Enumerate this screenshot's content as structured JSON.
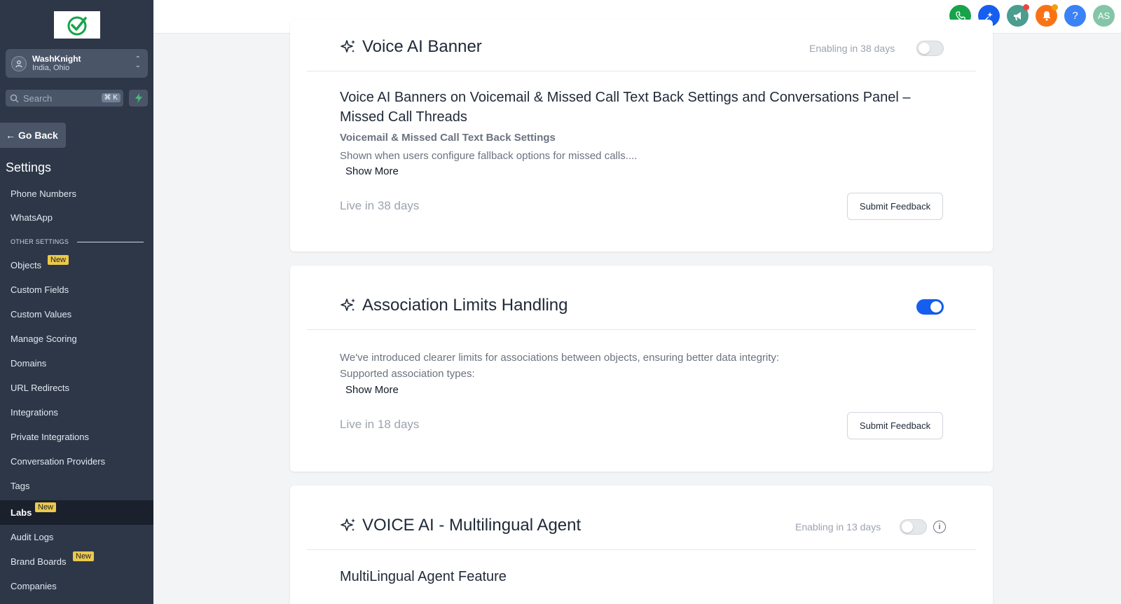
{
  "sidebar": {
    "account": {
      "name": "WashKnight",
      "location": "India, Ohio"
    },
    "search": {
      "placeholder": "Search",
      "shortcut": "⌘ K"
    },
    "go_back": "Go Back",
    "settings_title": "Settings",
    "other_settings_label": "OTHER SETTINGS",
    "new_badge": "New",
    "items": {
      "phone_numbers": "Phone Numbers",
      "whatsapp": "WhatsApp",
      "objects": "Objects",
      "custom_fields": "Custom Fields",
      "custom_values": "Custom Values",
      "manage_scoring": "Manage Scoring",
      "domains": "Domains",
      "url_redirects": "URL Redirects",
      "integrations": "Integrations",
      "private_integrations": "Private Integrations",
      "conversation_providers": "Conversation Providers",
      "tags": "Tags",
      "labs": "Labs",
      "audit_logs": "Audit Logs",
      "brand_boards": "Brand Boards",
      "companies": "Companies"
    },
    "active_item": "Labs"
  },
  "topbar": {
    "avatar_initials": "AS",
    "help_glyph": "?",
    "colors": {
      "phone": "#16a34a",
      "ai": "#155eef",
      "announce": "#4a9d8f",
      "notify": "#f97316",
      "help": "#3b82f6",
      "avatar": "#84c5a8"
    }
  },
  "cards": [
    {
      "title": "Voice AI Banner",
      "enabling": "Enabling in 38 days",
      "enabled": false,
      "heading": "Voice AI Banners on Voicemail & Missed Call Text Back Settings and Conversations Panel – Missed Call Threads",
      "subheading": "Voicemail & Missed Call Text Back Settings",
      "description": "Shown when users configure fallback options for missed calls....",
      "show_more": "Show More",
      "live": "Live in 38 days",
      "feedback": "Submit Feedback"
    },
    {
      "title": "Association Limits Handling",
      "enabled": true,
      "description_1": "We've introduced clearer limits for associations between objects, ensuring better data integrity:",
      "description_2": "Supported association types:",
      "show_more": "Show More",
      "live": "Live in 18 days",
      "feedback": "Submit Feedback"
    },
    {
      "title": "VOICE AI - Multilingual Agent",
      "enabling": "Enabling in 13 days",
      "enabled": false,
      "info_glyph": "i",
      "heading": "MultiLingual Agent Feature"
    }
  ]
}
